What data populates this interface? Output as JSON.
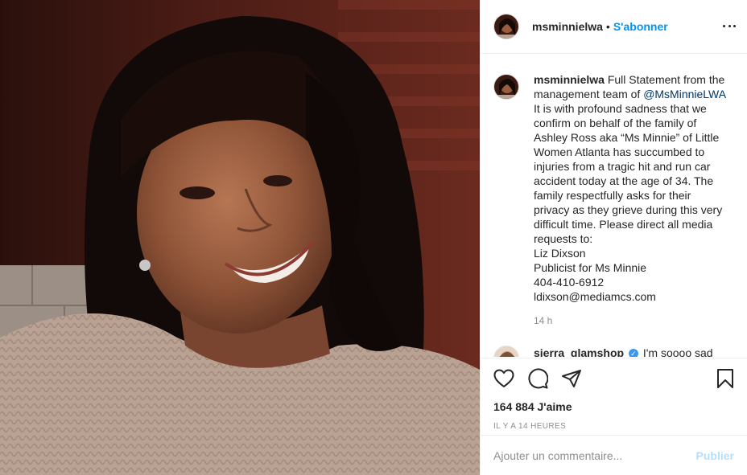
{
  "post": {
    "username": "msminnielwa",
    "separator": "•",
    "follow_label": "S'abonner",
    "photo_icon": "portrait-photo"
  },
  "caption": {
    "username": "msminnielwa",
    "lines": [
      "Full Statement from the",
      "management team of",
      "It is with profound sadness that we",
      "confirm on behalf of the family of",
      "Ashley Ross aka “Ms Minnie” of Little",
      "Women Atlanta has succumbed to",
      "injuries from a tragic hit and run car",
      "accident today at the age of 34. The",
      "family respectfully asks for their",
      "privacy as they grieve during this very",
      "difficult time. Please direct all media",
      "requests to:",
      "Liz Dixson",
      "Publicist for Ms Minnie",
      "404-410-6912",
      "ldixson@mediamcs.com"
    ],
    "mention": "@MsMinnieLWA",
    "time": "14 h"
  },
  "comments": [
    {
      "username": "sierra_glamshop",
      "text": "I'm soooo sad"
    }
  ],
  "actions": {
    "like_icon": "heart-icon",
    "comment_icon": "comment-icon",
    "share_icon": "paper-plane-icon",
    "save_icon": "bookmark-icon"
  },
  "likes": "164 884 J'aime",
  "posted_ago": "IL Y A 14 HEURES",
  "add_comment": {
    "placeholder": "Ajouter un commentaire...",
    "post_label": "Publier"
  },
  "colors": {
    "accent": "#0095f6",
    "mention": "#00376b",
    "muted": "#8e8e8e",
    "post_disabled": "#b2dffc"
  }
}
